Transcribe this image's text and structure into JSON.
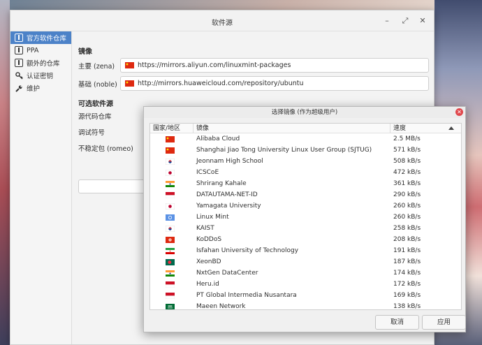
{
  "window": {
    "title": "软件源",
    "controls": {
      "minimize": "–",
      "maximize": "⤢",
      "close": "✕"
    }
  },
  "sidebar": {
    "items": [
      {
        "label": "官方软件仓库",
        "icon": "box-icon",
        "active": true
      },
      {
        "label": "PPA",
        "icon": "box-icon",
        "active": false
      },
      {
        "label": "额外的仓库",
        "icon": "box-icon",
        "active": false
      },
      {
        "label": "认证密钥",
        "icon": "key-icon",
        "active": false
      },
      {
        "label": "维护",
        "icon": "wrench-icon",
        "active": false
      }
    ]
  },
  "mirrors": {
    "heading": "镜像",
    "main_label": "主要 (zena)",
    "main_url": "https://mirrors.aliyun.com/linuxmint-packages",
    "main_flag": "cn",
    "base_label": "基础 (noble)",
    "base_url": "http://mirrors.huaweicloud.com/repository/ubuntu",
    "base_flag": "cn"
  },
  "optional": {
    "heading": "可选软件源",
    "source_code": "源代码仓库",
    "debug_symbols": "调试符号",
    "unstable": "不稳定包 (romeo)"
  },
  "dialog": {
    "title": "选择镜像 (作为超级用户)",
    "close": "✕",
    "columns": {
      "country": "国家/地区",
      "mirror": "镜像",
      "speed": "速度"
    },
    "rows": [
      {
        "flag": "cn",
        "name": "Alibaba Cloud",
        "speed": "2.5 MB/s"
      },
      {
        "flag": "cn",
        "name": "Shanghai Jiao Tong University Linux User Group (SJTUG)",
        "speed": "571 kB/s"
      },
      {
        "flag": "kr",
        "name": "Jeonnam High School",
        "speed": "508 kB/s"
      },
      {
        "flag": "jp",
        "name": "ICSCoE",
        "speed": "472 kB/s"
      },
      {
        "flag": "in",
        "name": "Shrirang Kahale",
        "speed": "361 kB/s"
      },
      {
        "flag": "id",
        "name": "DATAUTAMA-NET-ID",
        "speed": "290 kB/s"
      },
      {
        "flag": "jp",
        "name": "Yamagata University",
        "speed": "260 kB/s"
      },
      {
        "flag": "un",
        "name": "Linux Mint",
        "speed": "260 kB/s"
      },
      {
        "flag": "kr",
        "name": "KAIST",
        "speed": "258 kB/s"
      },
      {
        "flag": "hk",
        "name": "KoDDoS",
        "speed": "208 kB/s"
      },
      {
        "flag": "ir",
        "name": "Isfahan University of Technology",
        "speed": "191 kB/s"
      },
      {
        "flag": "bd",
        "name": "XeonBD",
        "speed": "187 kB/s"
      },
      {
        "flag": "in",
        "name": "NxtGen DataCenter",
        "speed": "174 kB/s"
      },
      {
        "flag": "id",
        "name": "Heru.id",
        "speed": "172 kB/s"
      },
      {
        "flag": "id",
        "name": "PT Global Intermedia Nusantara",
        "speed": "169 kB/s"
      },
      {
        "flag": "sa",
        "name": "Maeen Network",
        "speed": "138 kB/s"
      }
    ],
    "cancel": "取消",
    "apply": "应用"
  },
  "colors": {
    "accent": "#4c82c8",
    "close_red": "#e0474c"
  }
}
